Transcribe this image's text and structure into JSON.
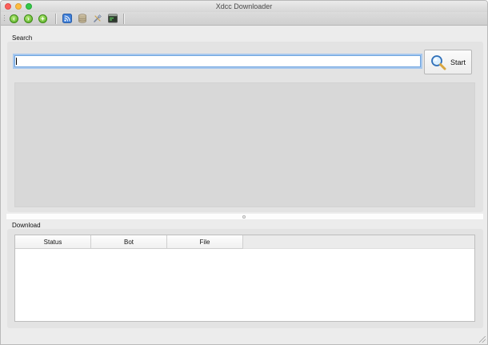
{
  "window": {
    "title": "Xdcc Downloader"
  },
  "toolbar": {
    "buttons": [
      {
        "icon": "green-circle-left-icon",
        "glyph": "‹"
      },
      {
        "icon": "green-circle-right-icon",
        "glyph": "›"
      },
      {
        "icon": "green-circle-plus-icon",
        "glyph": "+"
      },
      {
        "icon": "rss-feed-icon"
      },
      {
        "icon": "database-icon"
      },
      {
        "icon": "wrench-tools-icon"
      },
      {
        "icon": "terminal-window-icon"
      }
    ]
  },
  "search": {
    "group_label": "Search",
    "input_value": "",
    "start_label": "Start",
    "start_icon": "magnifier-icon"
  },
  "download": {
    "group_label": "Download",
    "columns": [
      "Status",
      "Bot",
      "File"
    ],
    "rows": []
  },
  "colors": {
    "window_bg": "#ececec",
    "input_focus": "#6fa5e0",
    "traffic_close": "#fc605c",
    "traffic_min": "#fdbc40",
    "traffic_max": "#34c84a"
  }
}
